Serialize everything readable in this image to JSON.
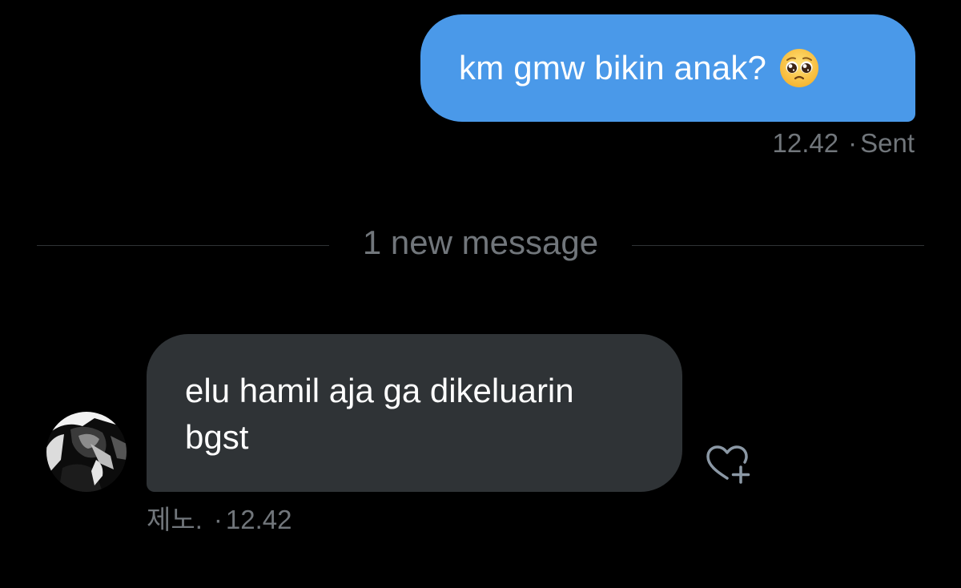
{
  "conversation": {
    "outgoing": {
      "text": "km gmw bikin anak?",
      "emoji": "pleading-face",
      "time": "12.42",
      "separator": "·",
      "status": "Sent",
      "bubble_color": "#4a99e9"
    },
    "divider": {
      "label": "1 new message"
    },
    "incoming": {
      "lines": [
        "elu hamil aja ga dikeluarin",
        "bgst"
      ],
      "sender": "제노.",
      "separator": "·",
      "time": "12.42",
      "bubble_color": "#2f3336",
      "avatar_icon": "avatar-photo",
      "react_icon": "heart-plus-icon"
    }
  },
  "colors": {
    "background": "#000000",
    "meta_text": "#71767b",
    "divider_line": "#2f3336"
  }
}
